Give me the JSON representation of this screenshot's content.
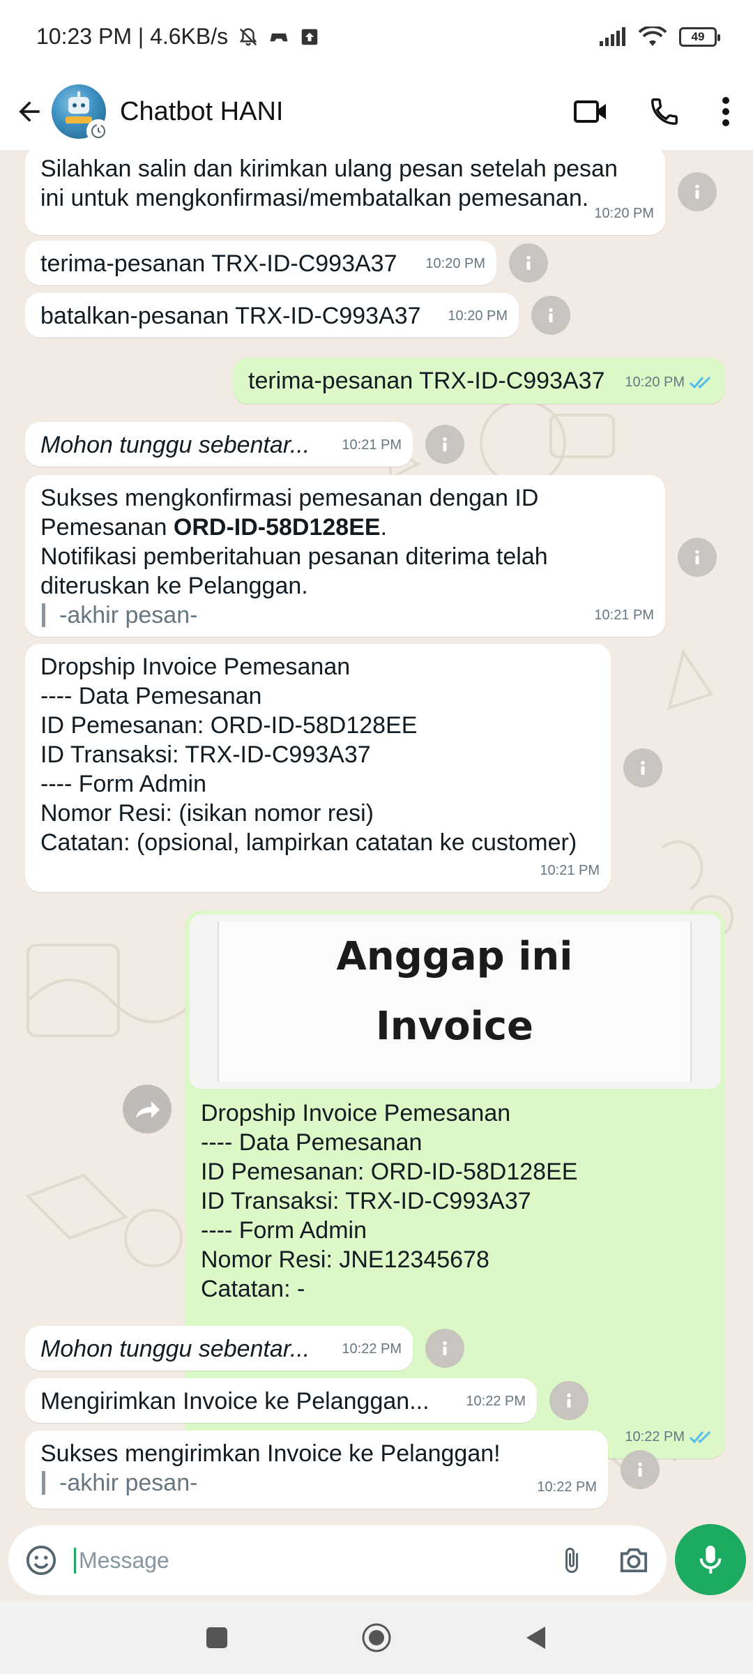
{
  "status_bar": {
    "time": "10:23 PM | 4.6KB/s",
    "battery": "49"
  },
  "header": {
    "title": "Chatbot HANI",
    "avatar_text": "CHATBOT"
  },
  "messages": [
    {
      "dir": "in",
      "lines": [
        "Silahkan salin dan kirimkan ulang pesan setelah pesan",
        "ini untuk mengkonfirmasi/membatalkan pemesanan."
      ],
      "time": "10:20 PM"
    },
    {
      "dir": "in",
      "text": "terima-pesanan TRX-ID-C993A37",
      "time": "10:20 PM"
    },
    {
      "dir": "in",
      "text": "batalkan-pesanan TRX-ID-C993A37",
      "time": "10:20 PM"
    },
    {
      "dir": "out",
      "text": "terima-pesanan TRX-ID-C993A37",
      "time": "10:20 PM"
    },
    {
      "dir": "in",
      "text": "Mohon tunggu sebentar...",
      "time": "10:21 PM"
    },
    {
      "dir": "in",
      "line1": "Sukses mengkonfirmasi pemesanan dengan ID",
      "line2_pre": "Pemesanan ",
      "line2_bold": "ORD-ID-58D128EE",
      "line2_post": ".",
      "line3": "Notifikasi pemberitahuan pesanan diterima telah",
      "line4": "diteruskan ke Pelanggan.",
      "quote": "-akhir pesan-",
      "time": "10:21 PM"
    },
    {
      "dir": "in",
      "lines": [
        "Dropship Invoice Pemesanan",
        "---- Data Pemesanan",
        "ID Pemesanan: ORD-ID-58D128EE",
        "ID Transaksi: TRX-ID-C993A37",
        "---- Form Admin",
        "Nomor Resi: (isikan nomor resi)",
        "Catatan: (opsional, lampirkan catatan ke customer)"
      ],
      "time": "10:21 PM"
    },
    {
      "dir": "out",
      "image_text": [
        "Anggap ini",
        "Invoice"
      ],
      "lines": [
        "Dropship Invoice Pemesanan",
        "---- Data Pemesanan",
        "ID Pemesanan: ORD-ID-58D128EE",
        "ID Transaksi: TRX-ID-C993A37",
        "---- Form Admin",
        "Nomor Resi: JNE12345678",
        "Catatan: -"
      ],
      "time": "10:22 PM"
    },
    {
      "dir": "in",
      "text": "Mohon tunggu sebentar...",
      "time": "10:22 PM"
    },
    {
      "dir": "in",
      "text": "Mengirimkan Invoice ke Pelanggan...",
      "time": "10:22 PM"
    },
    {
      "dir": "in",
      "text": "Sukses mengirimkan Invoice ke Pelanggan!",
      "quote": "-akhir pesan-",
      "time": "10:22 PM"
    }
  ],
  "composer": {
    "placeholder": "Message"
  },
  "colors": {
    "incoming": "#ffffff",
    "outgoing": "#dcf8c6",
    "accent": "#1daa61",
    "read_ticks": "#53bdeb",
    "wallpaper": "#f1ebe3"
  },
  "icons": [
    "back-arrow-icon",
    "video-call-icon",
    "phone-icon",
    "more-vert-icon",
    "info-icon",
    "forward-icon",
    "emoji-icon",
    "attach-icon",
    "camera-icon",
    "mic-icon",
    "nav-recents-icon",
    "nav-home-icon",
    "nav-back-icon"
  ]
}
